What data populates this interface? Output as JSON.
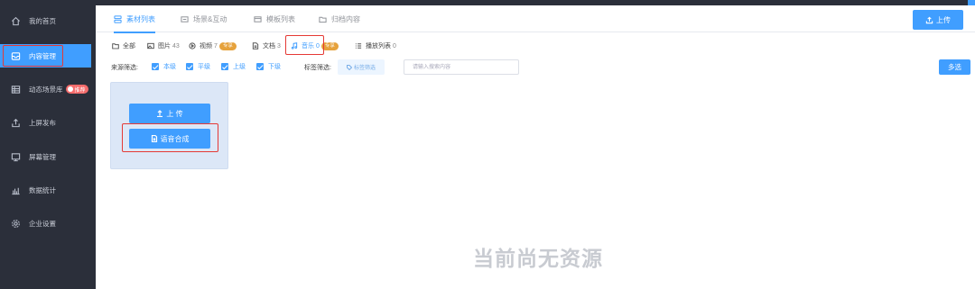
{
  "sidebar": {
    "items": [
      {
        "label": "我的首页",
        "icon": "home-icon"
      },
      {
        "label": "内容管理",
        "icon": "inbox-icon",
        "active": true
      },
      {
        "label": "动态场景库",
        "icon": "table-icon",
        "badge": "推荐"
      },
      {
        "label": "上屏发布",
        "icon": "upload-icon"
      },
      {
        "label": "屏幕管理",
        "icon": "monitor-icon"
      },
      {
        "label": "数据统计",
        "icon": "chart-icon"
      },
      {
        "label": "企业设置",
        "icon": "gear-icon"
      }
    ]
  },
  "tabs": [
    {
      "label": "素材列表",
      "icon": "layers-icon",
      "active": true
    },
    {
      "label": "场景&互动",
      "icon": "scene-icon"
    },
    {
      "label": "模板列表",
      "icon": "template-icon"
    },
    {
      "label": "归档内容",
      "icon": "folder-icon"
    }
  ],
  "upload_top_label": "上传",
  "subtabs": {
    "all": {
      "label": "全部"
    },
    "image": {
      "label": "图片",
      "count": "43"
    },
    "video": {
      "label": "视频",
      "count": "7",
      "badge": "专享"
    },
    "doc": {
      "label": "文档",
      "count": "3"
    },
    "music": {
      "label": "音乐",
      "count": "0",
      "badge": "专享"
    },
    "playlist": {
      "label": "播放列表",
      "count": "0"
    }
  },
  "filters": {
    "source_label": "来源筛选:",
    "options": [
      "本级",
      "平级",
      "上级",
      "下级"
    ],
    "tag_label": "标签筛选:",
    "tag_button": "标签筛选",
    "search_placeholder": "请输入搜索内容",
    "multi_select": "多选"
  },
  "card": {
    "upload_label": "上 传",
    "tts_label": "语音合成"
  },
  "empty_text": "当前尚无资源",
  "colors": {
    "sidebar_bg": "#2b2f3a",
    "accent": "#409eff",
    "badge_red": "#f56c6c",
    "badge_orange": "#e6a23c",
    "highlight_red": "#e53935"
  }
}
